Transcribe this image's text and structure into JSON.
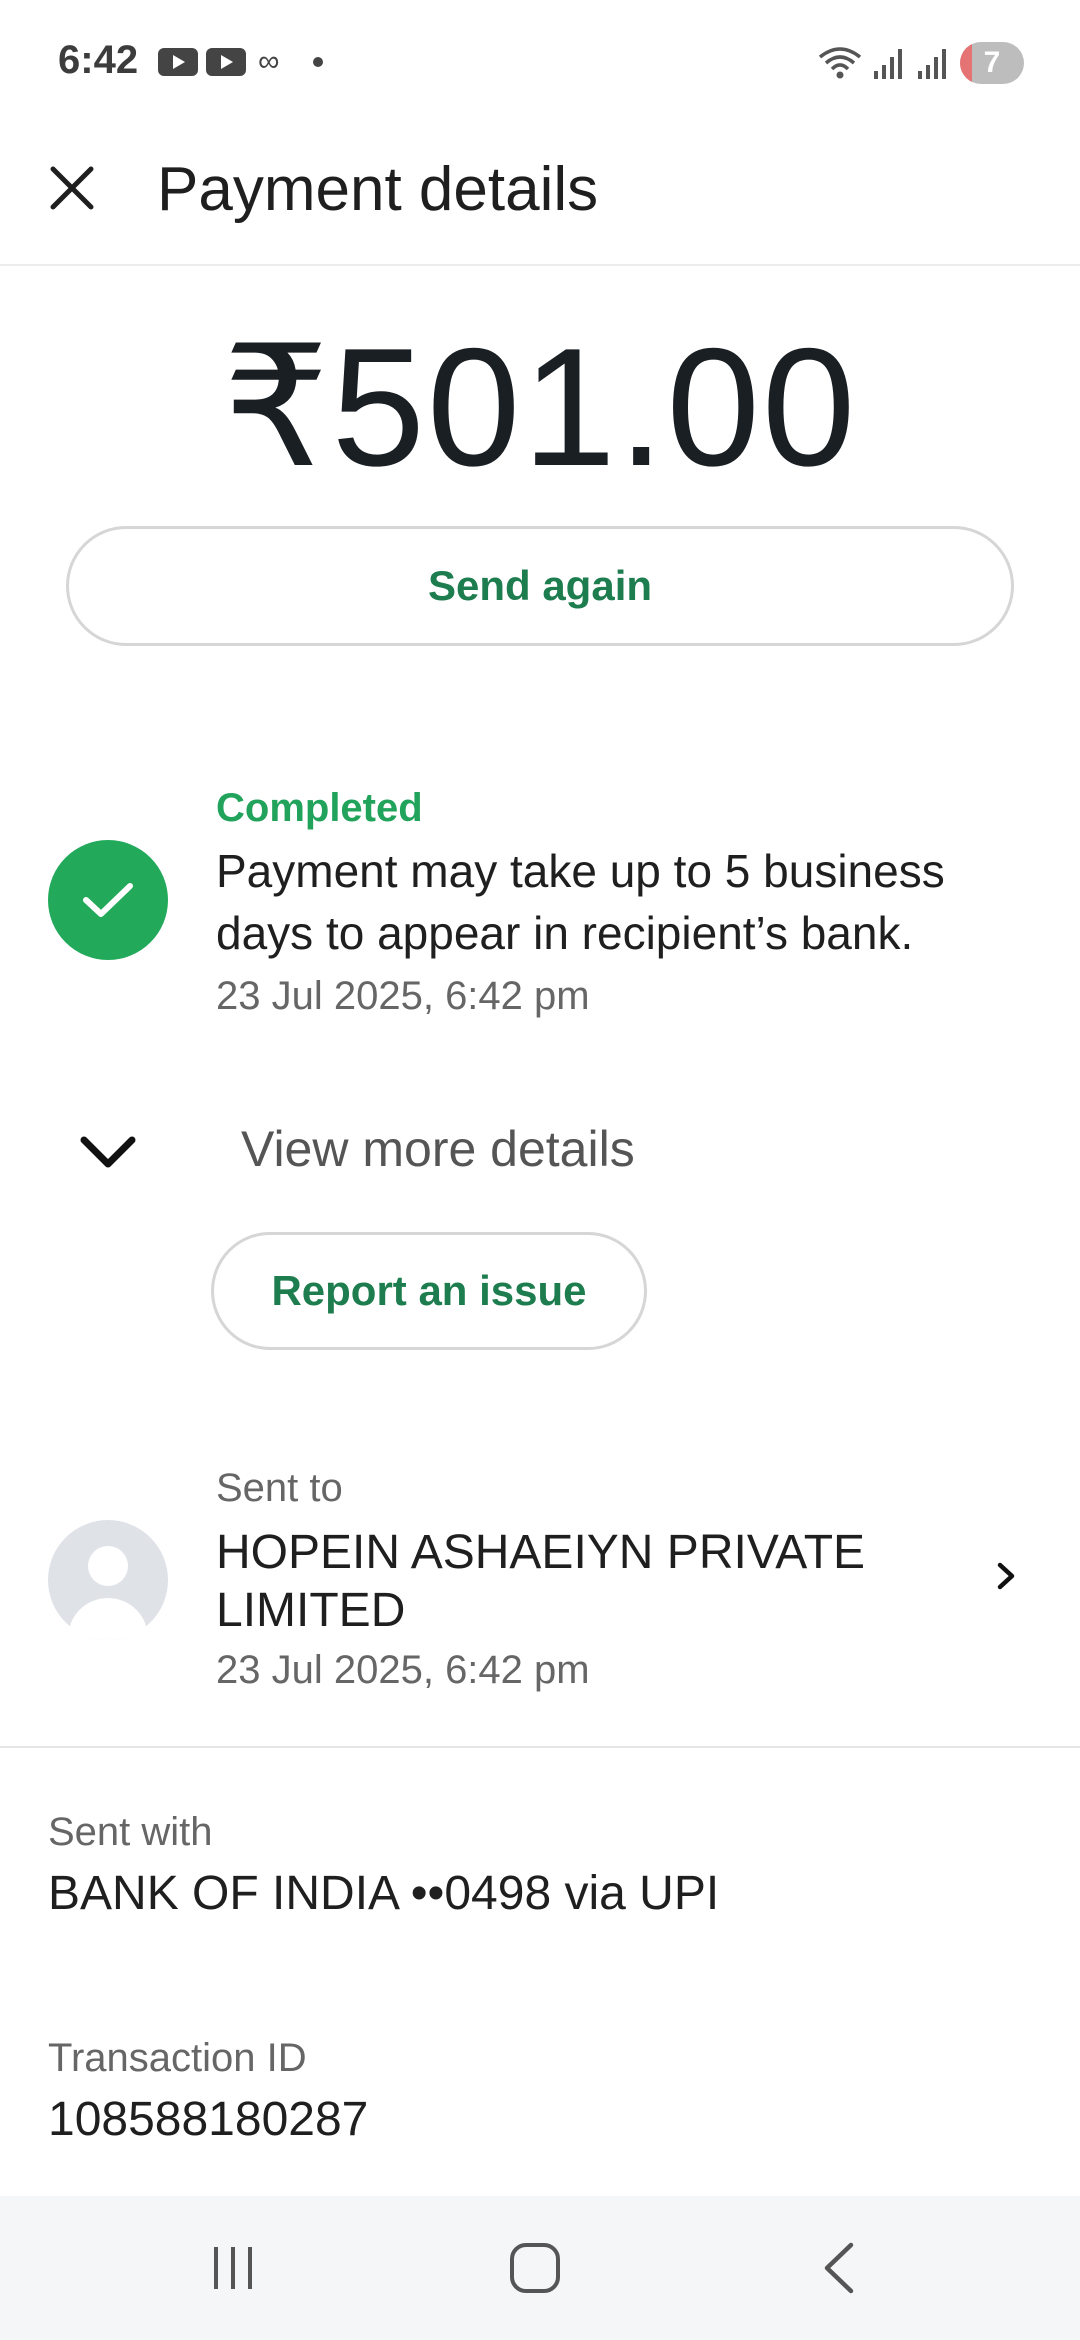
{
  "status_bar": {
    "time": "6:42",
    "left_icons": [
      "youtube-icon",
      "youtube-icon",
      "glasses-icon",
      "dot-icon"
    ],
    "right_icons": [
      "wifi-icon",
      "signal-icon",
      "signal-icon"
    ],
    "battery_level": "7"
  },
  "header": {
    "close_icon": "close-icon",
    "title": "Payment details"
  },
  "payment": {
    "amount": "₹501.00",
    "send_again_label": "Send again"
  },
  "status": {
    "icon": "check-icon",
    "label": "Completed",
    "message": "Payment may take up to 5 business days to appear in recipient’s bank.",
    "timestamp": "23 Jul 2025, 6:42 pm"
  },
  "view_more": {
    "icon": "chevron-down-icon",
    "label": "View more details"
  },
  "report": {
    "label": "Report an issue"
  },
  "sent_to": {
    "label": "Sent to",
    "recipient": "HOPEIN ASHAEIYN PRIVATE LIMITED",
    "timestamp": "23 Jul 2025, 6:42 pm",
    "icon": "chevron-right-icon"
  },
  "sent_with": {
    "label": "Sent with",
    "value": "BANK OF INDIA ••0498 via UPI"
  },
  "transaction": {
    "label": "Transaction ID",
    "value": "108588180287"
  },
  "nav": {
    "items": [
      "recent-apps-icon",
      "home-icon",
      "back-icon"
    ]
  },
  "colors": {
    "accent_green": "#1e7d4f",
    "success_green": "#22a95a",
    "text_primary": "#1f1f1f",
    "text_secondary": "#666666"
  }
}
